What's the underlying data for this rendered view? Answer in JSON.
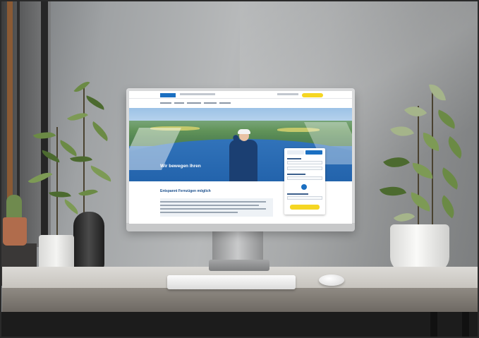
{
  "scene": {
    "description_free": true,
    "colors": {
      "wall": "#b7b9ba",
      "desk": "#dcdad6",
      "monitor_bezel": "#0f0f0f",
      "brand_blue": "#1b6fc1",
      "cta_yellow": "#f5d623"
    }
  },
  "website": {
    "hero_title": "Wir bewegen Ihren",
    "content_heading": "Entspannt Fernzügen möglich"
  },
  "icons": {
    "logo": "brand-logo"
  }
}
